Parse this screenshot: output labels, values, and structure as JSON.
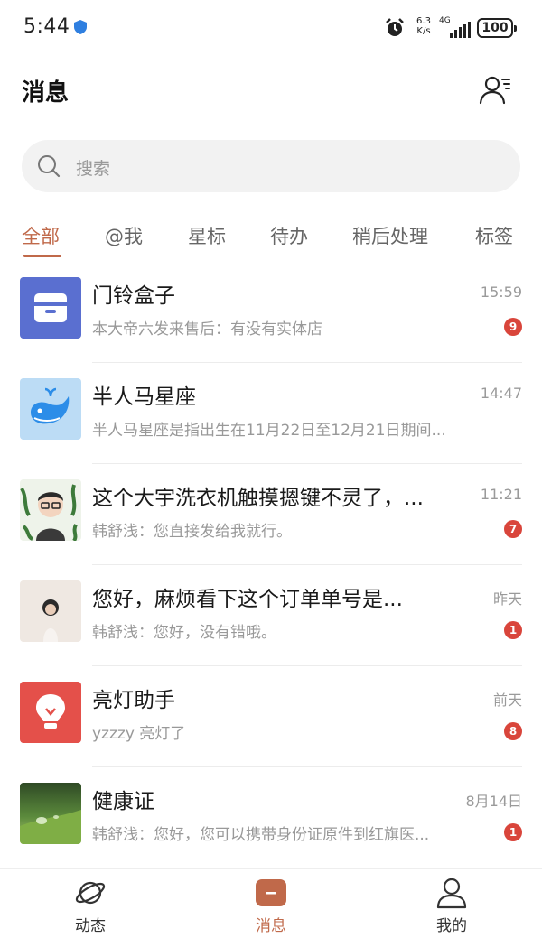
{
  "status_bar": {
    "time": "5:44",
    "net_speed_value": "6.3",
    "net_speed_unit": "K/s",
    "network": "4G",
    "battery": "100"
  },
  "header": {
    "title": "消息",
    "contacts_icon": "contacts-icon"
  },
  "search": {
    "placeholder": "搜索"
  },
  "tabs": [
    {
      "label": "全部",
      "active": true
    },
    {
      "label": "@我"
    },
    {
      "label": "星标"
    },
    {
      "label": "待办"
    },
    {
      "label": "稍后处理"
    },
    {
      "label": "标签"
    }
  ],
  "messages": [
    {
      "title": "门铃盒子",
      "time": "15:59",
      "preview": "本大帝六发来售后：有没有实体店",
      "badge": "9",
      "avatar_icon": "inbox-box-icon",
      "avatar_color": "#5a6fd0"
    },
    {
      "title": "半人马星座",
      "time": "14:47",
      "preview": "半人马星座是指出生在11月22日至12月21日期间...",
      "avatar_icon": "whale-icon",
      "avatar_color": "#bcdcf5"
    },
    {
      "title": "这个大宇洗衣机触摸摁键不灵了，...",
      "time": "11:21",
      "preview": "韩舒浅：您直接发给我就行。",
      "badge": "7",
      "avatar_icon": "cartoon-avatar-icon"
    },
    {
      "title": "您好，麻烦看下这个订单单号是...",
      "time": "昨天",
      "preview": "韩舒浅：您好，没有错哦。",
      "badge": "1",
      "avatar_icon": "girl-photo-avatar"
    },
    {
      "title": "亮灯助手",
      "time": "前天",
      "preview": "yzzzy 亮灯了",
      "badge": "8",
      "avatar_icon": "lightbulb-icon",
      "avatar_color": "#e4504a"
    },
    {
      "title": "健康证",
      "time": "8月14日",
      "preview": "韩舒浅：您好，您可以携带身份证原件到红旗医...",
      "badge": "1",
      "avatar_icon": "leaf-photo-avatar"
    }
  ],
  "bottom_nav": [
    {
      "label": "动态",
      "icon": "planet-icon"
    },
    {
      "label": "消息",
      "icon": "message-icon",
      "active": true
    },
    {
      "label": "我的",
      "icon": "person-icon"
    }
  ],
  "colors": {
    "accent": "#c0694a",
    "badge": "#d9453b"
  }
}
